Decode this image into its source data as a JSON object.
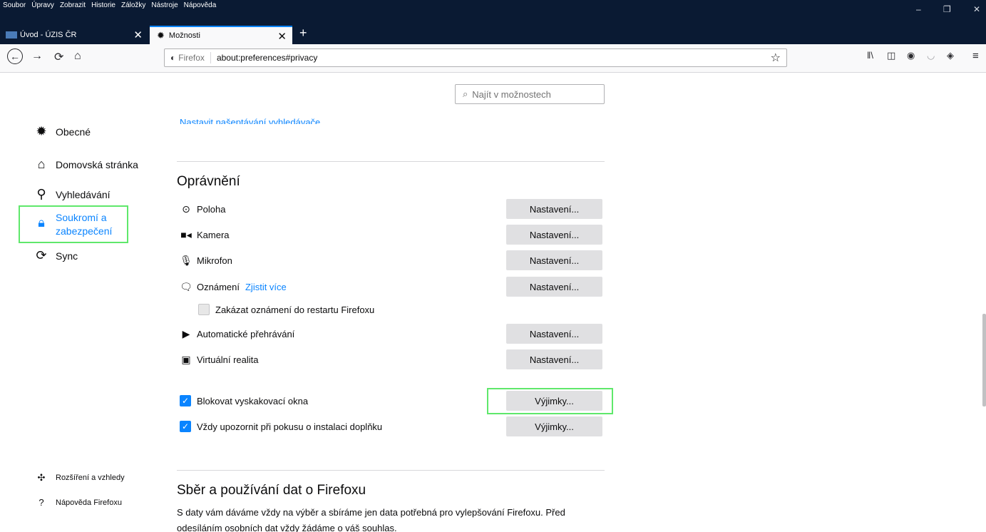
{
  "menu": [
    "Soubor",
    "Úpravy",
    "Zobrazit",
    "Historie",
    "Záložky",
    "Nástroje",
    "Nápověda"
  ],
  "window_controls": {
    "minimize": "–",
    "restore": "❐",
    "close": "✕"
  },
  "tabs": [
    {
      "label": "Úvod - ÚZIS ČR",
      "close": "✕"
    },
    {
      "label": "Možnosti",
      "close": "✕"
    }
  ],
  "new_tab": "+",
  "nav": {
    "back": "←",
    "forward": "→",
    "reload": "⟳",
    "home": "⌂"
  },
  "urlbar": {
    "identity": "Firefox",
    "url": "about:preferences#privacy",
    "star": "☆"
  },
  "toolbar_icons": [
    "library-icon",
    "sidebar-icon",
    "account-icon",
    "pocket-icon",
    "ublock-icon",
    "menu-icon"
  ],
  "search": {
    "placeholder": "Najít v možnostech",
    "icon": "⌕"
  },
  "sidebar": {
    "items": [
      {
        "label": "Obecné",
        "icon": "gear-icon"
      },
      {
        "label": "Domovská stránka",
        "icon": "home-icon"
      },
      {
        "label": "Vyhledávání",
        "icon": "search-icon"
      },
      {
        "label": "Soukromí a zabezpečení",
        "label_line1": "Soukromí a",
        "label_line2": "zabezpečení",
        "icon": "lock-icon"
      },
      {
        "label": "Sync",
        "icon": "sync-icon"
      }
    ],
    "footer": [
      {
        "label": "Rozšíření a vzhledy",
        "icon": "puzzle-icon"
      },
      {
        "label": "Nápověda Firefoxu",
        "icon": "help-icon"
      }
    ]
  },
  "partial_link": "Nastavit našeptávání vyhledávače",
  "permissions": {
    "title": "Oprávnění",
    "rows": [
      {
        "label": "Poloha",
        "button": "Nastavení..."
      },
      {
        "label": "Kamera",
        "button": "Nastavení..."
      },
      {
        "label": "Mikrofon",
        "button": "Nastavení..."
      },
      {
        "label": "Oznámení",
        "link": "Zjistit více",
        "button": "Nastavení..."
      },
      {
        "label": "Automatické přehrávání",
        "button": "Nastavení..."
      },
      {
        "label": "Virtuální realita",
        "button": "Nastavení..."
      }
    ],
    "notif_checkbox": "Zakázat oznámení do restartu Firefoxu",
    "popup_checkbox": "Blokovat vyskakovací okna",
    "popup_button": "Výjimky...",
    "addon_checkbox": "Vždy upozornit při pokusu o instalaci doplňku",
    "addon_button": "Výjimky..."
  },
  "data_section": {
    "title": "Sběr a používání dat o Firefoxu",
    "line1": "S daty vám dáváme vždy na výběr a sbíráme jen data potřebná pro vylepšování Firefoxu. Před",
    "line2": "odesíláním osobních dat vždy žádáme o váš souhlas."
  },
  "colors": {
    "accent": "#0a84ff",
    "highlight": "#5fe86b",
    "titlebar": "#0a1a33"
  }
}
